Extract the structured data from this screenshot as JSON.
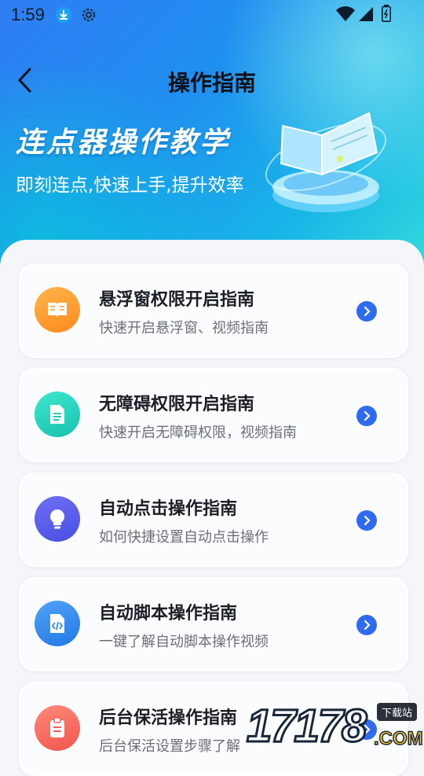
{
  "status_bar": {
    "time": "1:59",
    "icons": [
      "download-icon",
      "settings-icon",
      "wifi-icon",
      "signal-icon",
      "battery-icon"
    ]
  },
  "nav": {
    "back_icon": "chevron-left-icon",
    "title": "操作指南"
  },
  "banner": {
    "title": "连点器操作教学",
    "subtitle": "即刻连点,快速上手,提升效率",
    "illustration": "book-icon"
  },
  "guides": [
    {
      "title": "悬浮窗权限开启指南",
      "subtitle": "快速开启悬浮窗、视频指南",
      "icon": "book-icon",
      "color": "#ff9a2e"
    },
    {
      "title": "无障碍权限开启指南",
      "subtitle": "快速开启无障碍权限，视频指南",
      "icon": "document-icon",
      "color": "#22ccb8"
    },
    {
      "title": "自动点击操作指南",
      "subtitle": "如何快捷设置自动点击操作",
      "icon": "lightbulb-icon",
      "color": "#5556e8"
    },
    {
      "title": "自动脚本操作指南",
      "subtitle": "一键了解自动脚本操作视频",
      "icon": "code-file-icon",
      "color": "#2f86ec"
    },
    {
      "title": "后台保活操作指南",
      "subtitle": "后台保活设置步骤了解",
      "icon": "clipboard-icon",
      "color": "#f4605a"
    }
  ],
  "watermark": {
    "number": "17178",
    "tag": "下载站",
    "domain": ".COM"
  },
  "colors": {
    "accent": "#2f6bef",
    "header_gradient_start": "#2f7df3",
    "header_gradient_end": "#34d9da"
  }
}
